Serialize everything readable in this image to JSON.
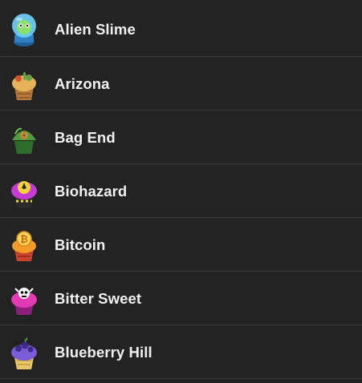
{
  "items": [
    {
      "label": "Alien Slime",
      "icon": "alien-slime-cupcake-icon",
      "colors": {
        "top": "#6fd3ff",
        "base": "#2f7fc1",
        "accent": "#8be06a"
      }
    },
    {
      "label": "Arizona",
      "icon": "arizona-cupcake-icon",
      "colors": {
        "top": "#e7b35a",
        "base": "#b77a3a",
        "accent": "#6aa04a"
      }
    },
    {
      "label": "Bag End",
      "icon": "bag-end-cupcake-icon",
      "colors": {
        "top": "#4f9b3f",
        "base": "#2f6d2a",
        "accent": "#c08a3a"
      }
    },
    {
      "label": "Biohazard",
      "icon": "biohazard-cupcake-icon",
      "colors": {
        "top": "#c43bd6",
        "base": "#7d1e8f",
        "accent": "#f2d33b"
      }
    },
    {
      "label": "Bitcoin",
      "icon": "bitcoin-cupcake-icon",
      "colors": {
        "top": "#f29a2a",
        "base": "#c9432f",
        "accent": "#ffd25a"
      }
    },
    {
      "label": "Bitter Sweet",
      "icon": "bitter-sweet-cupcake-icon",
      "colors": {
        "top": "#e23bb3",
        "base": "#8c1f7a",
        "accent": "#ffffff"
      }
    },
    {
      "label": "Blueberry Hill",
      "icon": "blueberry-hill-cupcake-icon",
      "colors": {
        "top": "#7b5bd6",
        "base": "#e8c56a",
        "accent": "#3d2a8a"
      }
    }
  ]
}
